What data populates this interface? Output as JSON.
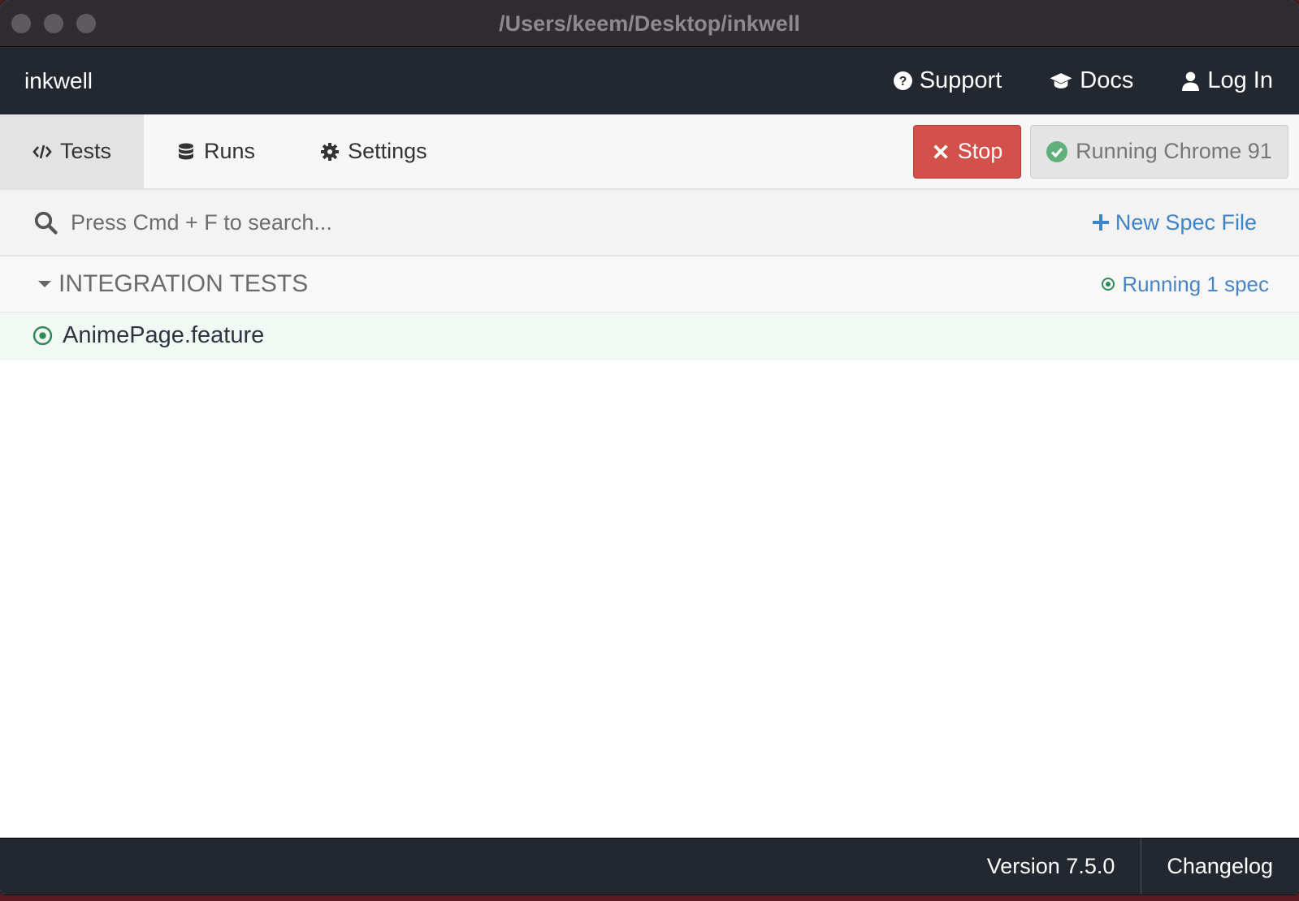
{
  "window": {
    "title": "/Users/keem/Desktop/inkwell"
  },
  "header": {
    "brand": "inkwell",
    "nav": [
      {
        "label": "Support",
        "icon": "question-circle-icon"
      },
      {
        "label": "Docs",
        "icon": "graduation-cap-icon"
      },
      {
        "label": "Log In",
        "icon": "user-icon"
      }
    ]
  },
  "tabs": [
    {
      "label": "Tests",
      "icon": "code-icon",
      "active": true
    },
    {
      "label": "Runs",
      "icon": "database-icon",
      "active": false
    },
    {
      "label": "Settings",
      "icon": "gear-icon",
      "active": false
    }
  ],
  "toolbar": {
    "stop_label": "Stop",
    "browser_label": "Running Chrome 91"
  },
  "search": {
    "placeholder": "Press Cmd + F to search...",
    "value": "",
    "new_spec_label": "New Spec File"
  },
  "section": {
    "name": "INTEGRATION TESTS",
    "status": "Running 1 spec"
  },
  "specs": [
    {
      "name": "AnimePage.feature"
    }
  ],
  "footer": {
    "version": "Version 7.5.0",
    "changelog": "Changelog"
  },
  "colors": {
    "header_bg": "#23272f",
    "stop_red": "#d2524b",
    "link_blue": "#3f84c8",
    "running_green": "#2e8b57"
  }
}
